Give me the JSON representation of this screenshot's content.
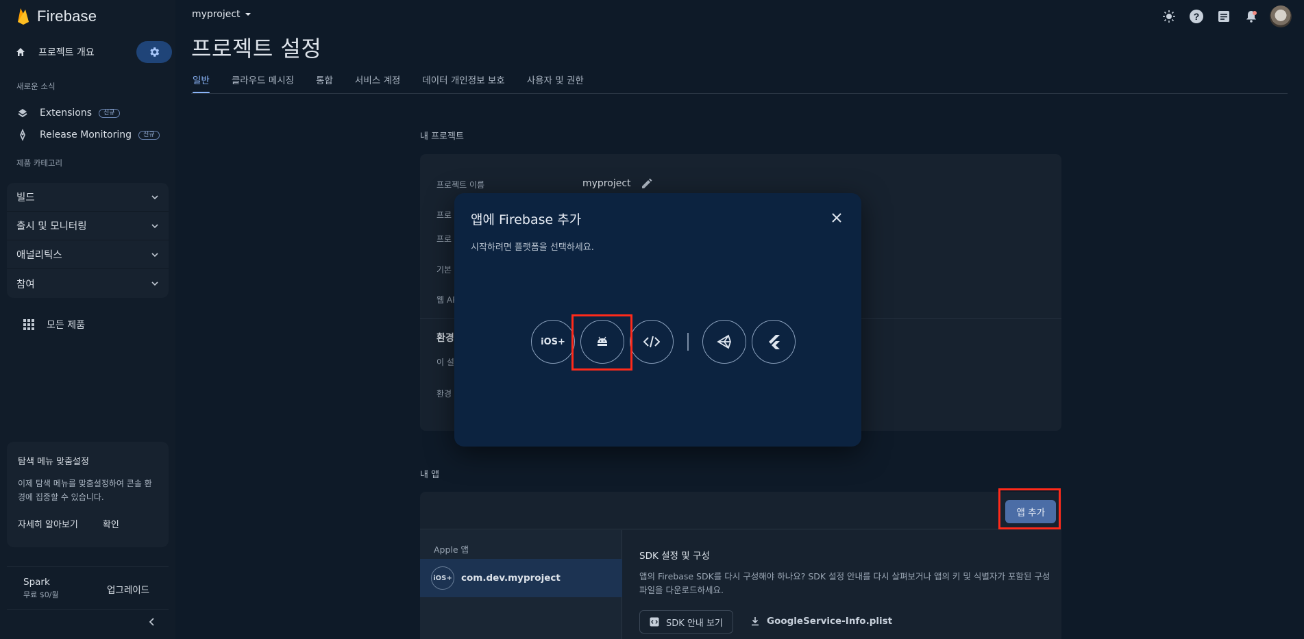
{
  "app": {
    "name": "Firebase"
  },
  "sidebar": {
    "overview_label": "프로젝트 개요",
    "news_section": "새로운 소식",
    "items": [
      {
        "label": "Extensions",
        "badge": "신규"
      },
      {
        "label": "Release Monitoring",
        "badge": "신규"
      }
    ],
    "category_section": "제품 카테고리",
    "categories": [
      "빌드",
      "출시 및 모니터링",
      "애널리틱스",
      "참여"
    ],
    "all_products": "모든 제품",
    "tip": {
      "title": "탐색 메뉴 맞춤설정",
      "body": "이제 탐색 메뉴를 맞춤설정하여 콘솔 환경에 집중할 수 있습니다.",
      "learn_more": "자세히 알아보기",
      "confirm": "확인"
    },
    "plan": {
      "name": "Spark",
      "price": "무료 $0/월",
      "upgrade": "업그레이드"
    }
  },
  "header": {
    "project": "myproject",
    "page_title": "프로젝트 설정",
    "tabs": [
      "일반",
      "클라우드 메시징",
      "통합",
      "서비스 계정",
      "데이터 개인정보 보호",
      "사용자 및 권한"
    ]
  },
  "project_section": {
    "label": "내 프로젝트",
    "rows": [
      {
        "key": "프로젝트 이름",
        "value": "myproject"
      },
      {
        "key": "프로"
      },
      {
        "key": "프로"
      },
      {
        "key": "기본"
      },
      {
        "key": "웹 AP"
      }
    ],
    "env_title": "환경",
    "env_rows": [
      "이 설",
      "환경"
    ]
  },
  "apps_section": {
    "label": "내 앱",
    "add_app": "앱 추가",
    "group": "Apple 앱",
    "app_badge": "iOS+",
    "app_name": "com.dev.myproject",
    "sdk_title": "SDK 설정 및 구성",
    "sdk_desc": "앱의 Firebase SDK를 다시 구성해야 하나요? SDK 설정 안내를 다시 살펴보거나 앱의 키 및 식별자가 포함된 구성 파일을 다운로드하세요.",
    "sdk_button": "SDK 안내 보기",
    "plist": "GoogleService-Info.plist"
  },
  "dialog": {
    "title": "앱에 Firebase 추가",
    "subtitle": "시작하려면 플랫폼을 선택하세요.",
    "platforms": [
      {
        "name": "ios-icon",
        "label": "iOS+"
      },
      {
        "name": "android-icon"
      },
      {
        "name": "web-icon"
      },
      {
        "name": "unity-icon"
      },
      {
        "name": "flutter-icon"
      }
    ]
  },
  "colors": {
    "highlight": "#ff2a1a",
    "accent": "#8ab4f8",
    "dialog_bg": "#0c2340"
  }
}
